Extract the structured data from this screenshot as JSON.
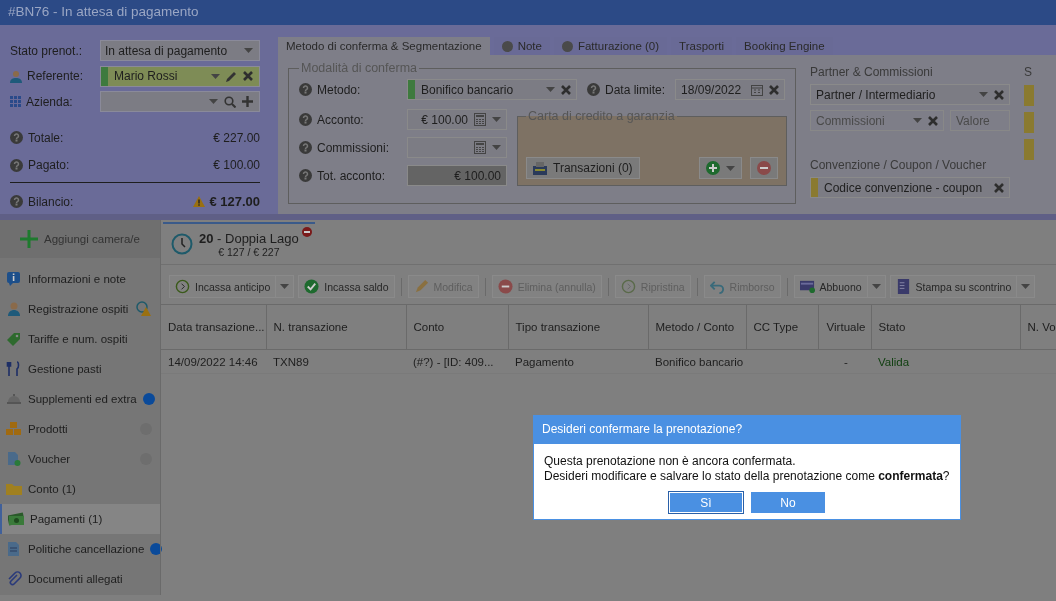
{
  "window": {
    "title": "#BN76 - In attesa di pagamento"
  },
  "booking": {
    "status": {
      "label": "Stato prenot.:",
      "value": "In attesa di pagamento"
    },
    "referente": {
      "label": "Referente:",
      "value": "Mario Rossi"
    },
    "azienda": {
      "label": "Azienda:"
    },
    "totals": [
      {
        "label": "Totale:",
        "value": "€ 227.00"
      },
      {
        "label": "Pagato:",
        "value": "€ 100.00"
      }
    ],
    "balance": {
      "label": "Bilancio:",
      "value": "€ 127.00"
    }
  },
  "tabs": [
    {
      "label": "Metodo di conferma & Segmentazione",
      "selected": true,
      "kind": "plain"
    },
    {
      "label": "Note",
      "selected": false,
      "kind": "dot"
    },
    {
      "label": "Fatturazione (0)",
      "selected": false,
      "kind": "dot"
    },
    {
      "label": "Trasporti",
      "selected": false,
      "kind": "plain"
    },
    {
      "label": "Booking Engine",
      "selected": false,
      "kind": "plain"
    }
  ],
  "confirmation": {
    "legend": "Modalità di conferma",
    "metodo": {
      "label": "Metodo:",
      "value": "Bonifico bancario"
    },
    "data_limite": {
      "label": "Data limite:",
      "value": "18/09/2022"
    },
    "acconto": {
      "label": "Acconto:",
      "value": "€ 100.00"
    },
    "commissioni": {
      "label": "Commissioni:"
    },
    "tot_acconto": {
      "label": "Tot. acconto:",
      "value": "€ 100.00"
    },
    "credit_card": {
      "legend": "Carta di credito a garanzia",
      "button": "Transazioni (0)"
    }
  },
  "partner": {
    "heading": "Partner & Commissioni",
    "partner_value": "Partner / Intermediario",
    "commission_placeholder": "Commissioni",
    "value_placeholder": "Valore",
    "convention_heading": "Convenzione / Coupon / Voucher",
    "convention_value": "Codice convenzione - coupon"
  },
  "column_4": {
    "heading": "S"
  },
  "sidebar": {
    "add_button": "Aggiungi camera/e",
    "items": [
      {
        "label": "Informazioni e note",
        "selected": false
      },
      {
        "label": "Registrazione ospiti",
        "selected": false
      },
      {
        "label": "Tariffe e num. ospiti",
        "selected": false
      },
      {
        "label": "Gestione pasti",
        "selected": false
      },
      {
        "label": "Supplementi ed extra",
        "selected": false,
        "color": "#0a4a9a"
      },
      {
        "label": "Prodotti",
        "selected": false,
        "color": "#6e6e6e"
      },
      {
        "label": "Voucher",
        "selected": false,
        "color": "#6e6e6e"
      },
      {
        "label": "Conto (1)",
        "selected": false
      },
      {
        "label": "Pagamenti (1)",
        "selected": true
      },
      {
        "label": "Politiche cancellazione",
        "selected": false,
        "color": "#0a4a9a"
      },
      {
        "label": "Documenti allegati",
        "selected": false
      }
    ]
  },
  "room_tab": {
    "title": "**20** - Doppia Lago",
    "amounts": "€ 127 / € 227"
  },
  "toolbar": [
    {
      "label": "Incassa anticipo",
      "disabled": false,
      "dropdown": true
    },
    {
      "label": "Incassa saldo",
      "disabled": false,
      "dropdown": false
    },
    {
      "label": "Modifica",
      "disabled": true,
      "dropdown": false
    },
    {
      "label": "Elimina (annulla)",
      "disabled": true,
      "dropdown": false
    },
    {
      "label": "Ripristina",
      "disabled": true,
      "dropdown": false
    },
    {
      "label": "Rimborso",
      "disabled": true,
      "dropdown": false
    },
    {
      "label": "Abbuono",
      "disabled": false,
      "dropdown": true
    },
    {
      "label": "Stampa su scontrino",
      "disabled": false,
      "dropdown": true
    }
  ],
  "table": {
    "columns": [
      "Data transazione...",
      "N. transazione",
      "Conto",
      "Tipo transazione",
      "Metodo / Conto",
      "CC Type",
      "Virtuale",
      "Stato",
      "N. Vo"
    ],
    "rows": [
      [
        "14/09/2022 14:46",
        "TXN89",
        "(#?) - [ID: 409...",
        "Pagamento",
        "Bonifico bancario",
        "",
        "-",
        "Valida",
        ""
      ]
    ]
  },
  "dialog": {
    "title": "Desideri confermare la prenotazione?",
    "lines": [
      "Questa prenotazione non è ancora confermata.",
      "Desideri modificare e salvare lo stato della prenotazione come **confermata**?"
    ],
    "buttons": [
      {
        "label": "Sì",
        "selected": true
      },
      {
        "label": "No",
        "selected": false
      }
    ]
  }
}
